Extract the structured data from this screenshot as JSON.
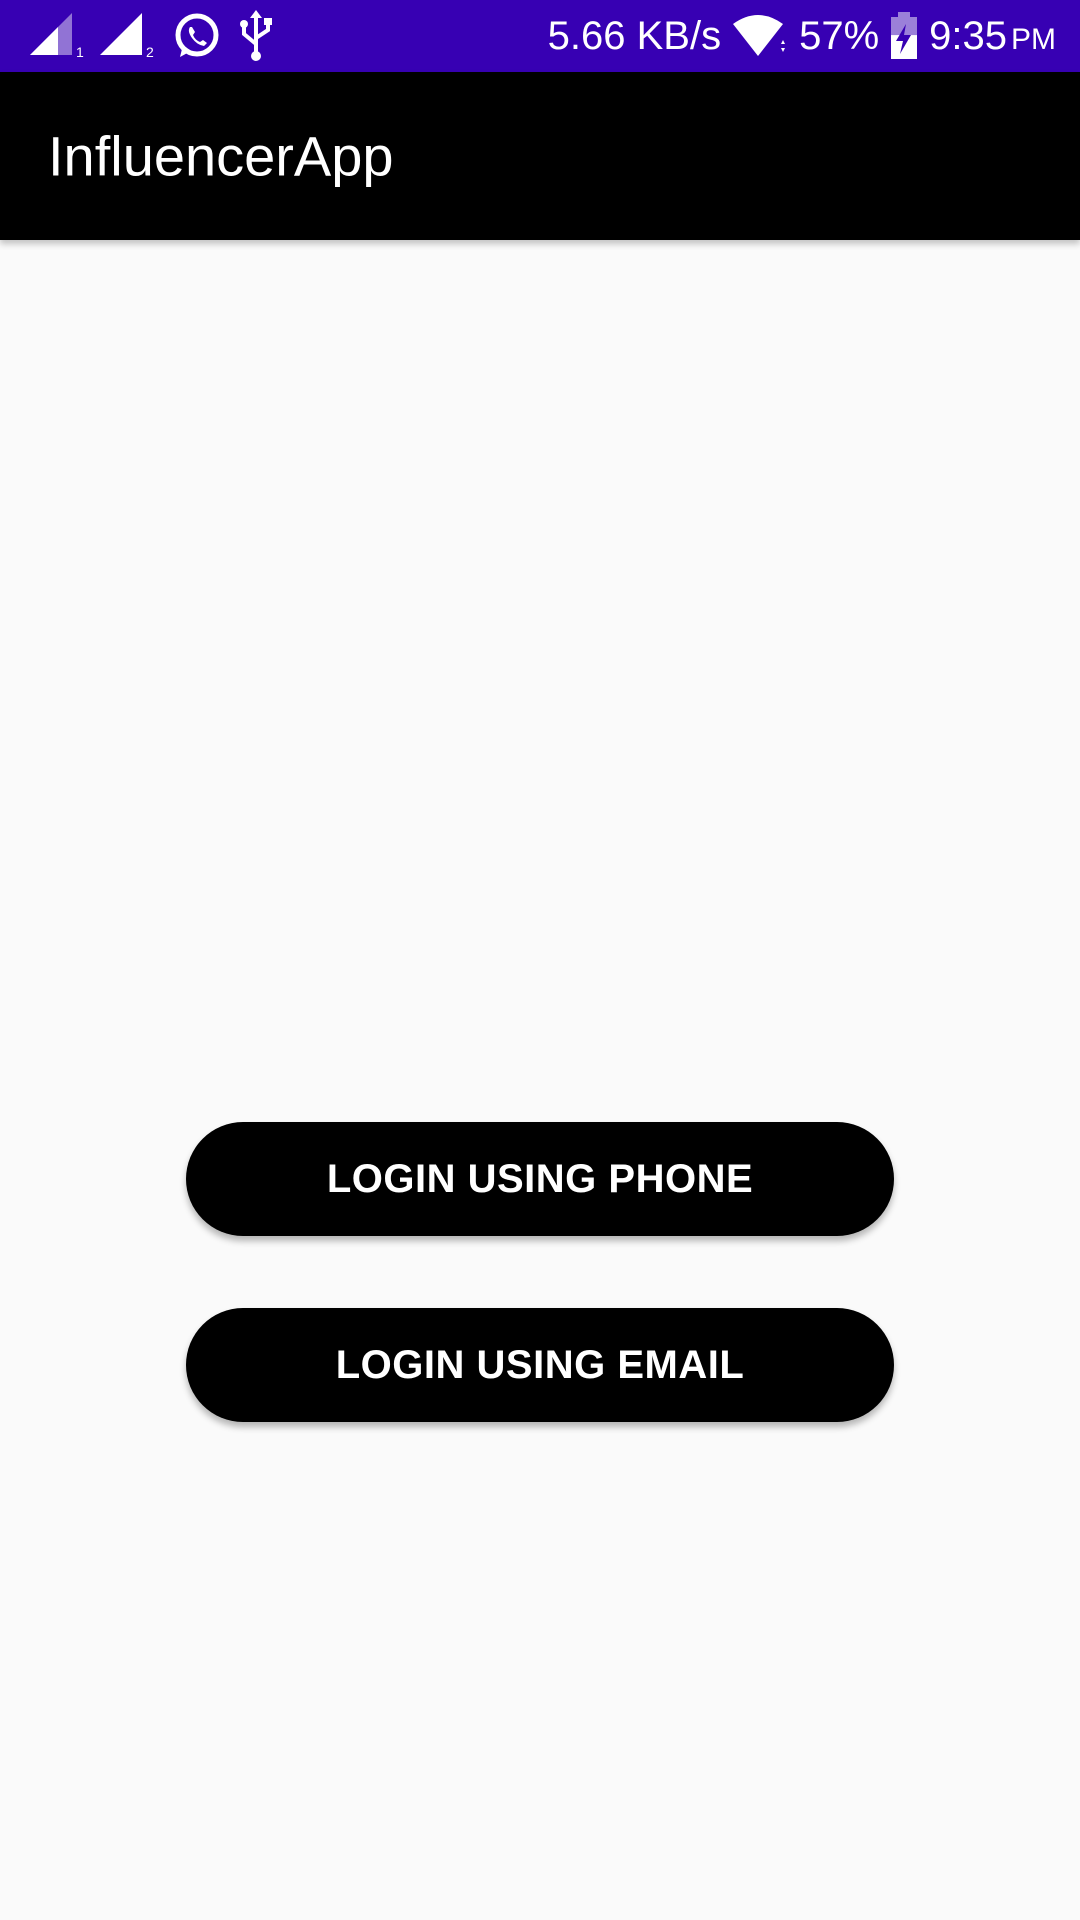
{
  "status_bar": {
    "background": "#3700b3",
    "sim1_label": "1",
    "sim2_label": "2",
    "net_speed": "5.66 KB/s",
    "battery_percent": "57%",
    "battery_level": 0.57,
    "time": "9:35",
    "ampm": "PM",
    "icons": [
      "signal-icon",
      "signal-icon",
      "whatsapp-icon",
      "usb-icon",
      "wifi-icon",
      "battery-charging-icon"
    ]
  },
  "app_bar": {
    "title": "InfluencerApp",
    "background": "#000000"
  },
  "main": {
    "background": "#fafafa",
    "buttons": {
      "phone_label": "LOGIN USING PHONE",
      "email_label": "LOGIN USING EMAIL"
    },
    "button_color": "#000000",
    "button_text_color": "#ffffff"
  }
}
